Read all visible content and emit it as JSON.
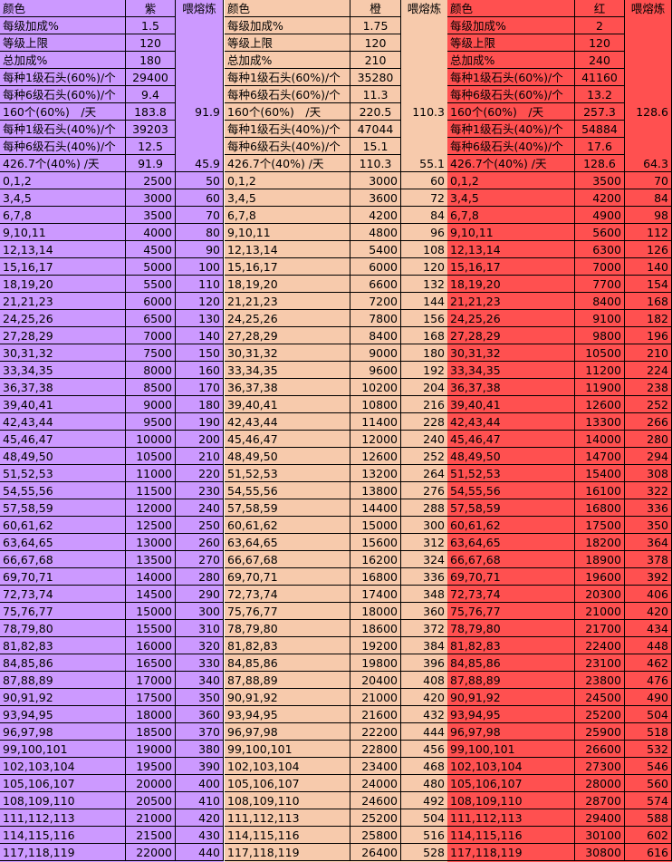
{
  "blocks": [
    {
      "color": "#cc99ff",
      "header": {
        "label": "颜色",
        "color_name": "紫",
        "feed_label": "喂熔炼"
      },
      "stats": [
        {
          "label": "每级加成%",
          "value": "1.5",
          "feed": ""
        },
        {
          "label": "等级上限",
          "value": "120",
          "feed": ""
        },
        {
          "label": "总加成%",
          "value": "180",
          "feed": ""
        },
        {
          "label": "每种1级石头(60%)/个",
          "value": "29400",
          "feed": ""
        },
        {
          "label": "每种6级石头(60%)/个",
          "value": "9.4",
          "feed": ""
        },
        {
          "label": "160个(60%)　/天",
          "value": "183.8",
          "feed": "91.9"
        },
        {
          "label": "每种1级石头(40%)/个",
          "value": "39203",
          "feed": ""
        },
        {
          "label": "每种6级石头(40%)/个",
          "value": "12.5",
          "feed": ""
        },
        {
          "label": "426.7个(40%) /天",
          "value": "91.9",
          "feed": "45.9"
        }
      ],
      "levels": [
        [
          "0,1,2",
          "2500",
          "50"
        ],
        [
          "3,4,5",
          "3000",
          "60"
        ],
        [
          "6,7,8",
          "3500",
          "70"
        ],
        [
          "9,10,11",
          "4000",
          "80"
        ],
        [
          "12,13,14",
          "4500",
          "90"
        ],
        [
          "15,16,17",
          "5000",
          "100"
        ],
        [
          "18,19,20",
          "5500",
          "110"
        ],
        [
          "21,21,23",
          "6000",
          "120"
        ],
        [
          "24,25,26",
          "6500",
          "130"
        ],
        [
          "27,28,29",
          "7000",
          "140"
        ],
        [
          "30,31,32",
          "7500",
          "150"
        ],
        [
          "33,34,35",
          "8000",
          "160"
        ],
        [
          "36,37,38",
          "8500",
          "170"
        ],
        [
          "39,40,41",
          "9000",
          "180"
        ],
        [
          "42,43,44",
          "9500",
          "190"
        ],
        [
          "45,46,47",
          "10000",
          "200"
        ],
        [
          "48,49,50",
          "10500",
          "210"
        ],
        [
          "51,52,53",
          "11000",
          "220"
        ],
        [
          "54,55,56",
          "11500",
          "230"
        ],
        [
          "57,58,59",
          "12000",
          "240"
        ],
        [
          "60,61,62",
          "12500",
          "250"
        ],
        [
          "63,64,65",
          "13000",
          "260"
        ],
        [
          "66,67,68",
          "13500",
          "270"
        ],
        [
          "69,70,71",
          "14000",
          "280"
        ],
        [
          "72,73,74",
          "14500",
          "290"
        ],
        [
          "75,76,77",
          "15000",
          "300"
        ],
        [
          "78,79,80",
          "15500",
          "310"
        ],
        [
          "81,82,83",
          "16000",
          "320"
        ],
        [
          "84,85,86",
          "16500",
          "330"
        ],
        [
          "87,88,89",
          "17000",
          "340"
        ],
        [
          "90,91,92",
          "17500",
          "350"
        ],
        [
          "93,94,95",
          "18000",
          "360"
        ],
        [
          "96,97,98",
          "18500",
          "370"
        ],
        [
          "99,100,101",
          "19000",
          "380"
        ],
        [
          "102,103,104",
          "19500",
          "390"
        ],
        [
          "105,106,107",
          "20000",
          "400"
        ],
        [
          "108,109,110",
          "20500",
          "410"
        ],
        [
          "111,112,113",
          "21000",
          "420"
        ],
        [
          "114,115,116",
          "21500",
          "430"
        ],
        [
          "117,118,119",
          "22000",
          "440"
        ]
      ]
    },
    {
      "color": "#f7caac",
      "header": {
        "label": "颜色",
        "color_name": "橙",
        "feed_label": "喂熔炼"
      },
      "stats": [
        {
          "label": "每级加成%",
          "value": "1.75",
          "feed": ""
        },
        {
          "label": "等级上限",
          "value": "120",
          "feed": ""
        },
        {
          "label": "总加成%",
          "value": "210",
          "feed": ""
        },
        {
          "label": "每种1级石头(60%)/个",
          "value": "35280",
          "feed": ""
        },
        {
          "label": "每种6级石头(60%)/个",
          "value": "11.3",
          "feed": ""
        },
        {
          "label": "160个(60%)　/天",
          "value": "220.5",
          "feed": "110.3"
        },
        {
          "label": "每种1级石头(40%)/个",
          "value": "47044",
          "feed": ""
        },
        {
          "label": "每种6级石头(40%)/个",
          "value": "15.1",
          "feed": ""
        },
        {
          "label": "426.7个(40%) /天",
          "value": "110.3",
          "feed": "55.1"
        }
      ],
      "levels": [
        [
          "0,1,2",
          "3000",
          "60"
        ],
        [
          "3,4,5",
          "3600",
          "72"
        ],
        [
          "6,7,8",
          "4200",
          "84"
        ],
        [
          "9,10,11",
          "4800",
          "96"
        ],
        [
          "12,13,14",
          "5400",
          "108"
        ],
        [
          "15,16,17",
          "6000",
          "120"
        ],
        [
          "18,19,20",
          "6600",
          "132"
        ],
        [
          "21,21,23",
          "7200",
          "144"
        ],
        [
          "24,25,26",
          "7800",
          "156"
        ],
        [
          "27,28,29",
          "8400",
          "168"
        ],
        [
          "30,31,32",
          "9000",
          "180"
        ],
        [
          "33,34,35",
          "9600",
          "192"
        ],
        [
          "36,37,38",
          "10200",
          "204"
        ],
        [
          "39,40,41",
          "10800",
          "216"
        ],
        [
          "42,43,44",
          "11400",
          "228"
        ],
        [
          "45,46,47",
          "12000",
          "240"
        ],
        [
          "48,49,50",
          "12600",
          "252"
        ],
        [
          "51,52,53",
          "13200",
          "264"
        ],
        [
          "54,55,56",
          "13800",
          "276"
        ],
        [
          "57,58,59",
          "14400",
          "288"
        ],
        [
          "60,61,62",
          "15000",
          "300"
        ],
        [
          "63,64,65",
          "15600",
          "312"
        ],
        [
          "66,67,68",
          "16200",
          "324"
        ],
        [
          "69,70,71",
          "16800",
          "336"
        ],
        [
          "72,73,74",
          "17400",
          "348"
        ],
        [
          "75,76,77",
          "18000",
          "360"
        ],
        [
          "78,79,80",
          "18600",
          "372"
        ],
        [
          "81,82,83",
          "19200",
          "384"
        ],
        [
          "84,85,86",
          "19800",
          "396"
        ],
        [
          "87,88,89",
          "20400",
          "408"
        ],
        [
          "90,91,92",
          "21000",
          "420"
        ],
        [
          "93,94,95",
          "21600",
          "432"
        ],
        [
          "96,97,98",
          "22200",
          "444"
        ],
        [
          "99,100,101",
          "22800",
          "456"
        ],
        [
          "102,103,104",
          "23400",
          "468"
        ],
        [
          "105,106,107",
          "24000",
          "480"
        ],
        [
          "108,109,110",
          "24600",
          "492"
        ],
        [
          "111,112,113",
          "25200",
          "504"
        ],
        [
          "114,115,116",
          "25800",
          "516"
        ],
        [
          "117,118,119",
          "26400",
          "528"
        ]
      ]
    },
    {
      "color": "#ff5050",
      "header": {
        "label": "颜色",
        "color_name": "红",
        "feed_label": "喂熔炼"
      },
      "stats": [
        {
          "label": "每级加成%",
          "value": "2",
          "feed": ""
        },
        {
          "label": "等级上限",
          "value": "120",
          "feed": ""
        },
        {
          "label": "总加成%",
          "value": "240",
          "feed": ""
        },
        {
          "label": "每种1级石头(60%)/个",
          "value": "41160",
          "feed": ""
        },
        {
          "label": "每种6级石头(60%)/个",
          "value": "13.2",
          "feed": ""
        },
        {
          "label": "160个(60%)　/天",
          "value": "257.3",
          "feed": "128.6"
        },
        {
          "label": "每种1级石头(40%)/个",
          "value": "54884",
          "feed": ""
        },
        {
          "label": "每种6级石头(40%)/个",
          "value": "17.6",
          "feed": ""
        },
        {
          "label": "426.7个(40%) /天",
          "value": "128.6",
          "feed": "64.3"
        }
      ],
      "levels": [
        [
          "0,1,2",
          "3500",
          "70"
        ],
        [
          "3,4,5",
          "4200",
          "84"
        ],
        [
          "6,7,8",
          "4900",
          "98"
        ],
        [
          "9,10,11",
          "5600",
          "112"
        ],
        [
          "12,13,14",
          "6300",
          "126"
        ],
        [
          "15,16,17",
          "7000",
          "140"
        ],
        [
          "18,19,20",
          "7700",
          "154"
        ],
        [
          "21,21,23",
          "8400",
          "168"
        ],
        [
          "24,25,26",
          "9100",
          "182"
        ],
        [
          "27,28,29",
          "9800",
          "196"
        ],
        [
          "30,31,32",
          "10500",
          "210"
        ],
        [
          "33,34,35",
          "11200",
          "224"
        ],
        [
          "36,37,38",
          "11900",
          "238"
        ],
        [
          "39,40,41",
          "12600",
          "252"
        ],
        [
          "42,43,44",
          "13300",
          "266"
        ],
        [
          "45,46,47",
          "14000",
          "280"
        ],
        [
          "48,49,50",
          "14700",
          "294"
        ],
        [
          "51,52,53",
          "15400",
          "308"
        ],
        [
          "54,55,56",
          "16100",
          "322"
        ],
        [
          "57,58,59",
          "16800",
          "336"
        ],
        [
          "60,61,62",
          "17500",
          "350"
        ],
        [
          "63,64,65",
          "18200",
          "364"
        ],
        [
          "66,67,68",
          "18900",
          "378"
        ],
        [
          "69,70,71",
          "19600",
          "392"
        ],
        [
          "72,73,74",
          "20300",
          "406"
        ],
        [
          "75,76,77",
          "21000",
          "420"
        ],
        [
          "78,79,80",
          "21700",
          "434"
        ],
        [
          "81,82,83",
          "22400",
          "448"
        ],
        [
          "84,85,86",
          "23100",
          "462"
        ],
        [
          "87,88,89",
          "23800",
          "476"
        ],
        [
          "90,91,92",
          "24500",
          "490"
        ],
        [
          "93,94,95",
          "25200",
          "504"
        ],
        [
          "96,97,98",
          "25900",
          "518"
        ],
        [
          "99,100,101",
          "26600",
          "532"
        ],
        [
          "102,103,104",
          "27300",
          "546"
        ],
        [
          "105,106,107",
          "28000",
          "560"
        ],
        [
          "108,109,110",
          "28700",
          "574"
        ],
        [
          "111,112,113",
          "29400",
          "588"
        ],
        [
          "114,115,116",
          "30100",
          "602"
        ],
        [
          "117,118,119",
          "30800",
          "616"
        ]
      ]
    }
  ]
}
